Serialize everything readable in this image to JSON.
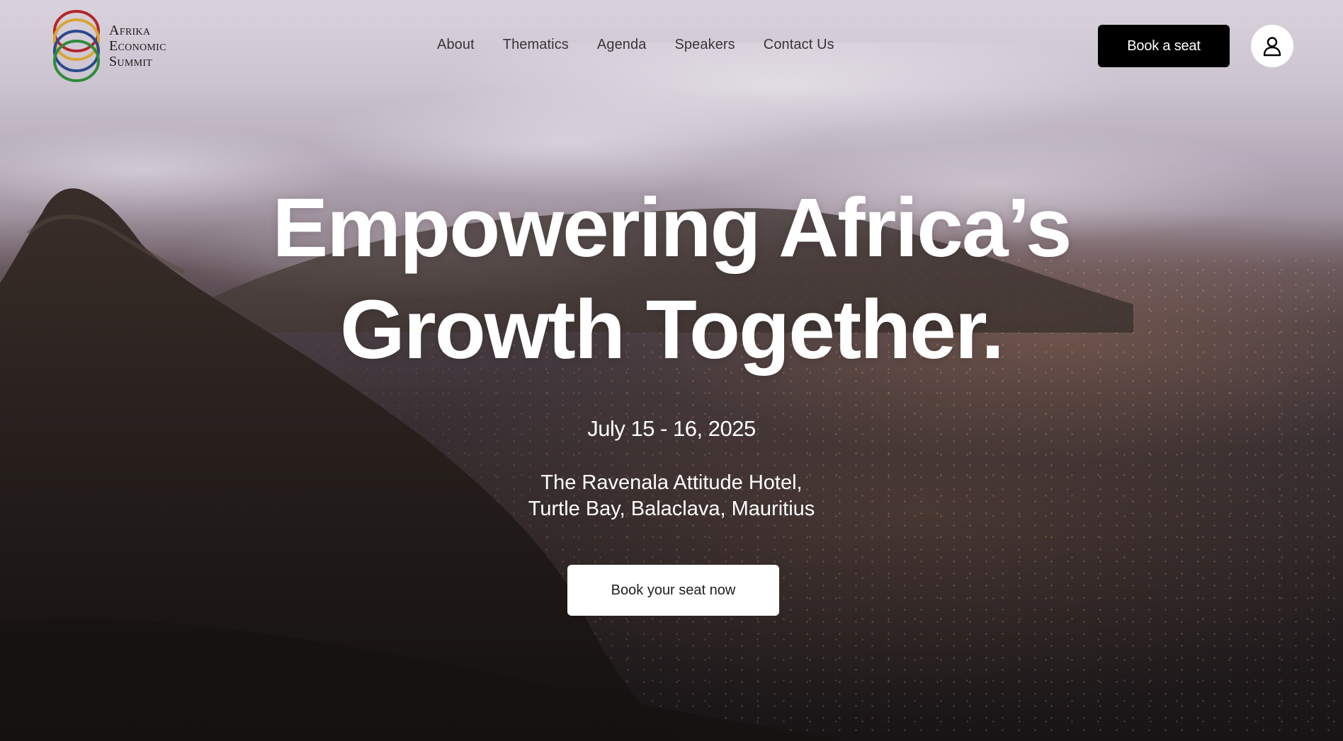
{
  "brand": {
    "name_lines": [
      "Afrika",
      "Economic",
      "Summit"
    ],
    "ring_colors": [
      "#b2262b",
      "#d8a534",
      "#2a4a8c",
      "#2e8b3a"
    ]
  },
  "nav": {
    "items": [
      {
        "label": "About"
      },
      {
        "label": "Thematics"
      },
      {
        "label": "Agenda"
      },
      {
        "label": "Speakers"
      },
      {
        "label": "Contact Us"
      }
    ]
  },
  "header": {
    "book_label": "Book a seat",
    "account_icon": "user-icon"
  },
  "hero": {
    "title_lines": [
      "Empowering Africa’s",
      "Growth Together."
    ],
    "date": "July 15 - 16, 2025",
    "venue_lines": [
      "The Ravenala Attitude Hotel,",
      "Turtle Bay, Balaclava, Mauritius"
    ],
    "cta_label": "Book your seat now"
  }
}
